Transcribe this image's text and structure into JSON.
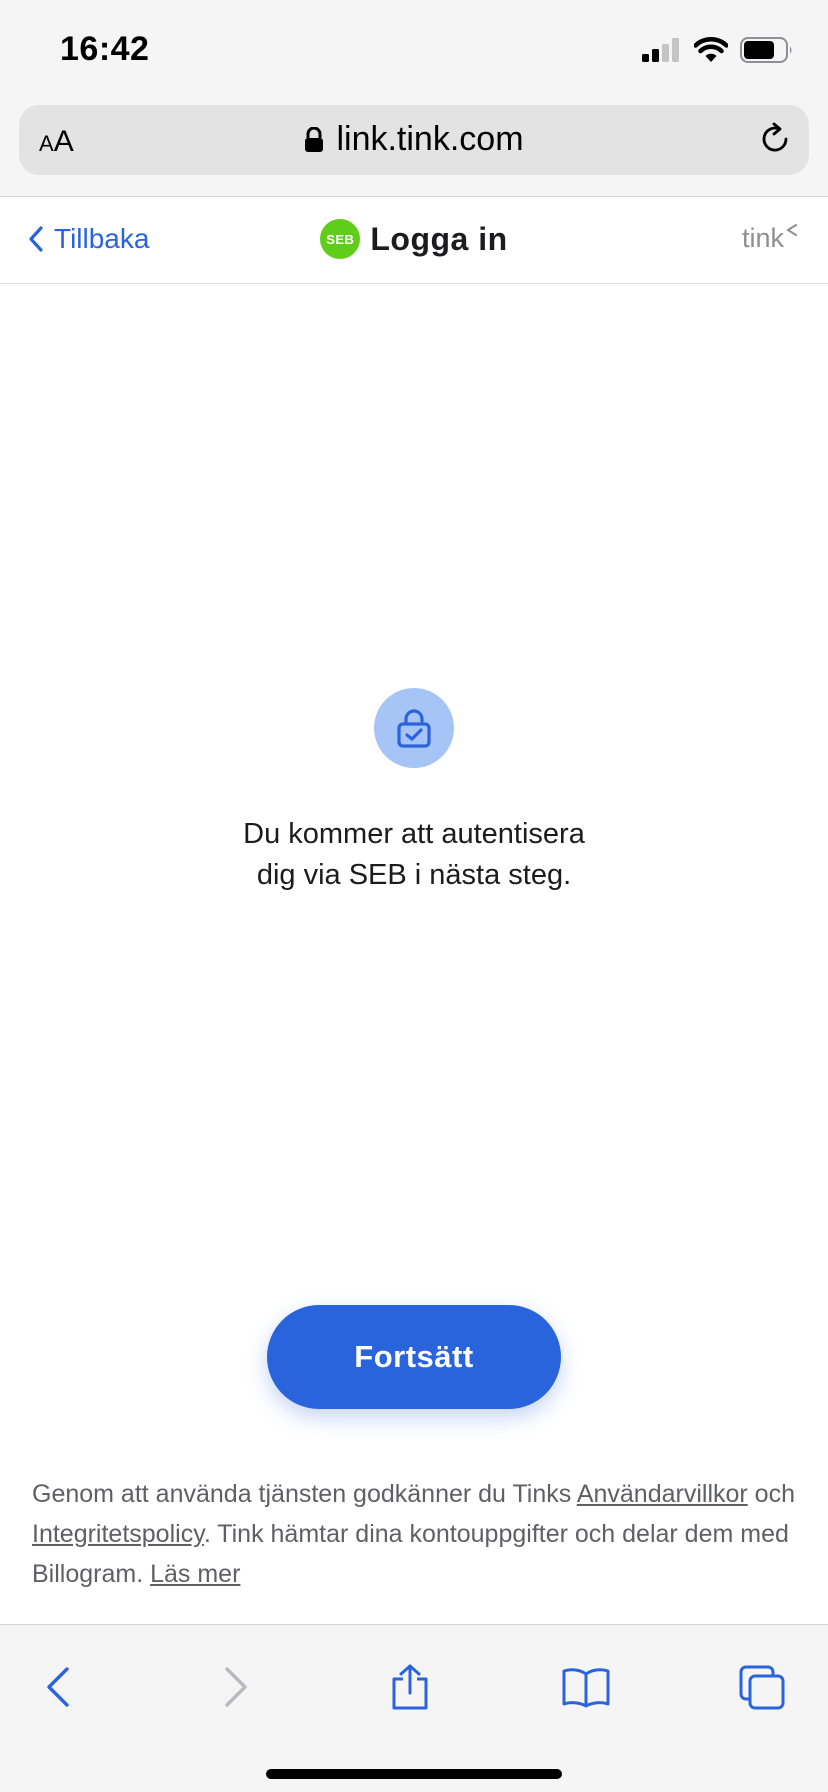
{
  "status_bar": {
    "time": "16:42",
    "icons": [
      "signal-icon",
      "wifi-icon",
      "battery-icon"
    ]
  },
  "url_bar": {
    "text_size_label_small": "A",
    "text_size_label_large": "A",
    "url": "link.tink.com",
    "icons": [
      "lock-icon",
      "reload-icon"
    ]
  },
  "header": {
    "back_label": "Tillbaka",
    "bank_logo_text": "SEB",
    "title": "Logga in",
    "brand": "tink"
  },
  "main": {
    "message_line1": "Du kommer att autentisera",
    "message_line2": "dig via SEB i nästa steg.",
    "continue_label": "Fortsätt"
  },
  "legal": {
    "text_1": "Genom att använda tjänsten godkänner du Tinks ",
    "terms_link": "Användarvillkor",
    "text_2": " och ",
    "privacy_link": "Integritetspolicy",
    "text_3": ". Tink hämtar dina kontouppgifter och delar dem med Billogram. ",
    "read_more_link": "Läs mer"
  },
  "toolbar": {
    "icons": [
      "back-arrow-icon",
      "forward-arrow-icon",
      "share-icon",
      "bookmarks-icon",
      "tabs-icon"
    ]
  },
  "colors": {
    "accent": "#2a64dd",
    "seb_green": "#60cd18",
    "lock_circle": "#a6c4f5"
  }
}
